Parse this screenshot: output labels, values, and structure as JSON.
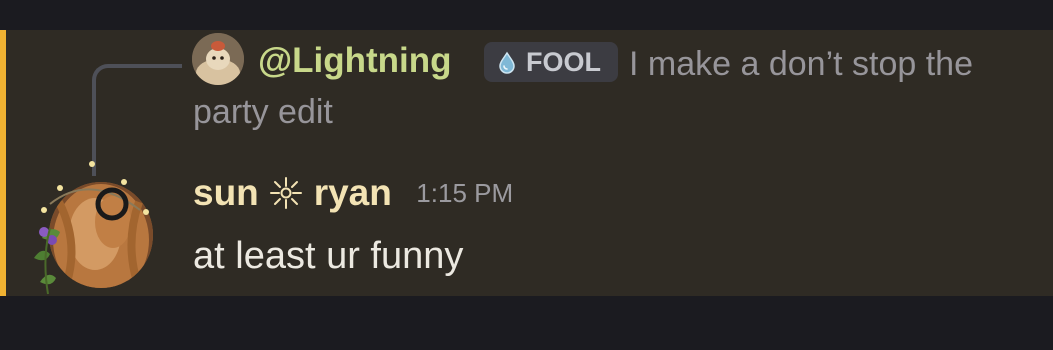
{
  "reply": {
    "author": "@Lightning",
    "role": "FOOL",
    "role_icon": "water-drop-icon",
    "text": "I make a don’t stop the party edit"
  },
  "message": {
    "author_first": "sun",
    "author_icon": "sun-icon",
    "author_last": "ryan",
    "timestamp": "1:15 PM",
    "content": "at least ur funny"
  },
  "colors": {
    "mention_highlight": "#f0b232",
    "reply_author": "#c8d88a",
    "author": "#f3e3b4",
    "message_background": "#2f2b24"
  }
}
